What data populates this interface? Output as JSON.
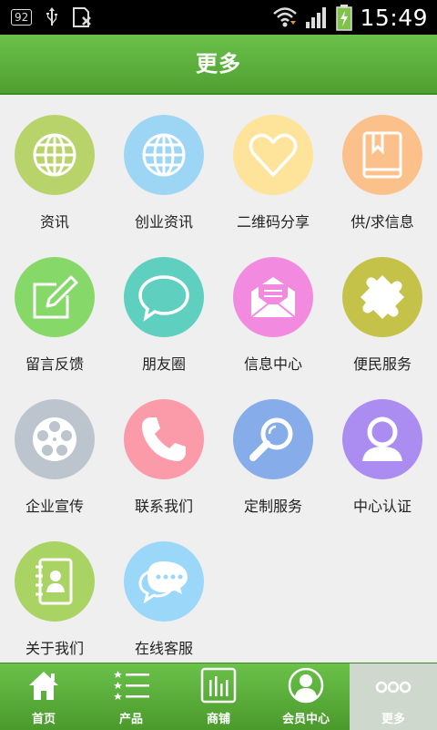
{
  "status_bar": {
    "notification_badge": "92",
    "time": "15:49"
  },
  "header": {
    "title": "更多"
  },
  "grid_items": [
    {
      "label": "资讯",
      "icon": "globe-icon",
      "color": "#b8d36a"
    },
    {
      "label": "创业资讯",
      "icon": "globe-icon",
      "color": "#9dd6f5"
    },
    {
      "label": "二维码分享",
      "icon": "heart-icon",
      "color": "#fde49a"
    },
    {
      "label": "供/求信息",
      "icon": "book-icon",
      "color": "#fcc08a"
    },
    {
      "label": "留言反馈",
      "icon": "edit-icon",
      "color": "#86d968"
    },
    {
      "label": "朋友圈",
      "icon": "chat-bubble-icon",
      "color": "#5fcfbf"
    },
    {
      "label": "信息中心",
      "icon": "mail-icon",
      "color": "#f28be0"
    },
    {
      "label": "便民服务",
      "icon": "puzzle-icon",
      "color": "#c5c24a"
    },
    {
      "label": "企业宣传",
      "icon": "film-reel-icon",
      "color": "#bcc4ce"
    },
    {
      "label": "联系我们",
      "icon": "phone-icon",
      "color": "#fb9aa8"
    },
    {
      "label": "定制服务",
      "icon": "magnifier-icon",
      "color": "#86acea"
    },
    {
      "label": "中心认证",
      "icon": "user-icon",
      "color": "#ab8cf0"
    },
    {
      "label": "关于我们",
      "icon": "contacts-icon",
      "color": "#a9d363"
    },
    {
      "label": "在线客服",
      "icon": "chat-dots-icon",
      "color": "#9bd7f8"
    }
  ],
  "tab_bar": [
    {
      "label": "首页",
      "icon": "home-icon"
    },
    {
      "label": "产品",
      "icon": "list-icon"
    },
    {
      "label": "商铺",
      "icon": "store-icon"
    },
    {
      "label": "会员中心",
      "icon": "member-icon"
    },
    {
      "label": "更多",
      "icon": "more-icon",
      "active": true
    }
  ]
}
